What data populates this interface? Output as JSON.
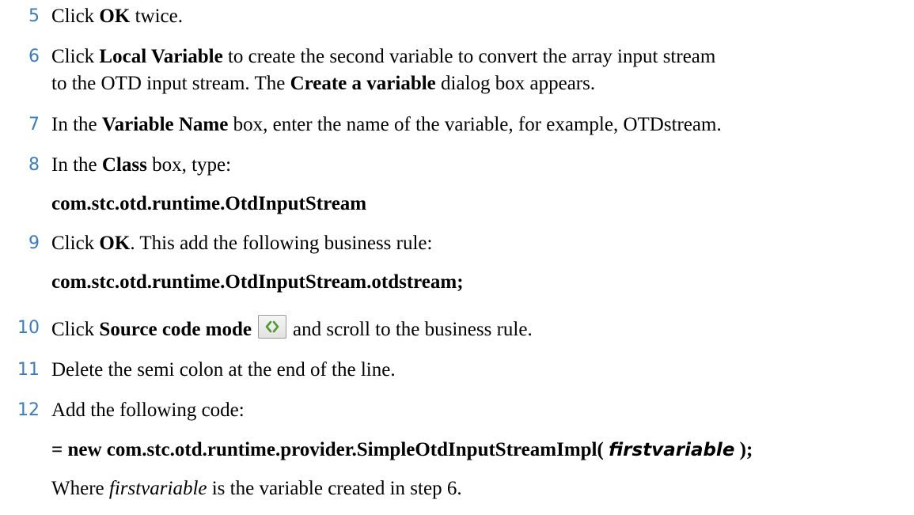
{
  "colors": {
    "step_number": "#3a7dbf",
    "icon_arrows": "#4f9a2e"
  },
  "steps": [
    {
      "number": "5",
      "parts": [
        "Click ",
        "OK",
        " twice."
      ]
    },
    {
      "number": "6",
      "line1": [
        "Click ",
        "Local Variable",
        " to create the second variable to convert the array input stream"
      ],
      "line2": [
        "to the OTD input stream. The ",
        "Create a variable",
        " dialog box appears."
      ]
    },
    {
      "number": "7",
      "parts": [
        "In the ",
        "Variable Name",
        " box, enter the name of the variable, for example, OTDstream."
      ]
    },
    {
      "number": "8",
      "parts": [
        "In the ",
        "Class",
        " box, type:"
      ],
      "code": "com.stc.otd.runtime.OtdInputStream"
    },
    {
      "number": "9",
      "parts": [
        "Click ",
        "OK",
        ". This add the following business rule:"
      ],
      "code": "com.stc.otd.runtime.OtdInputStream.otdstream;"
    },
    {
      "number": "10",
      "parts": [
        "Click ",
        "Source code mode",
        "and scroll to the business rule."
      ],
      "icon": "source-code-mode-icon"
    },
    {
      "number": "11",
      "text": "Delete the semi colon at the end of the line."
    },
    {
      "number": "12",
      "text": "Add the following code:",
      "code_parts": [
        "= new com.stc.otd.runtime.provider.SimpleOtdInputStreamImpl( ",
        "firstvariable",
        " );"
      ],
      "note_parts": [
        "Where ",
        "firstvariable",
        " is the variable created in step 6."
      ]
    }
  ]
}
